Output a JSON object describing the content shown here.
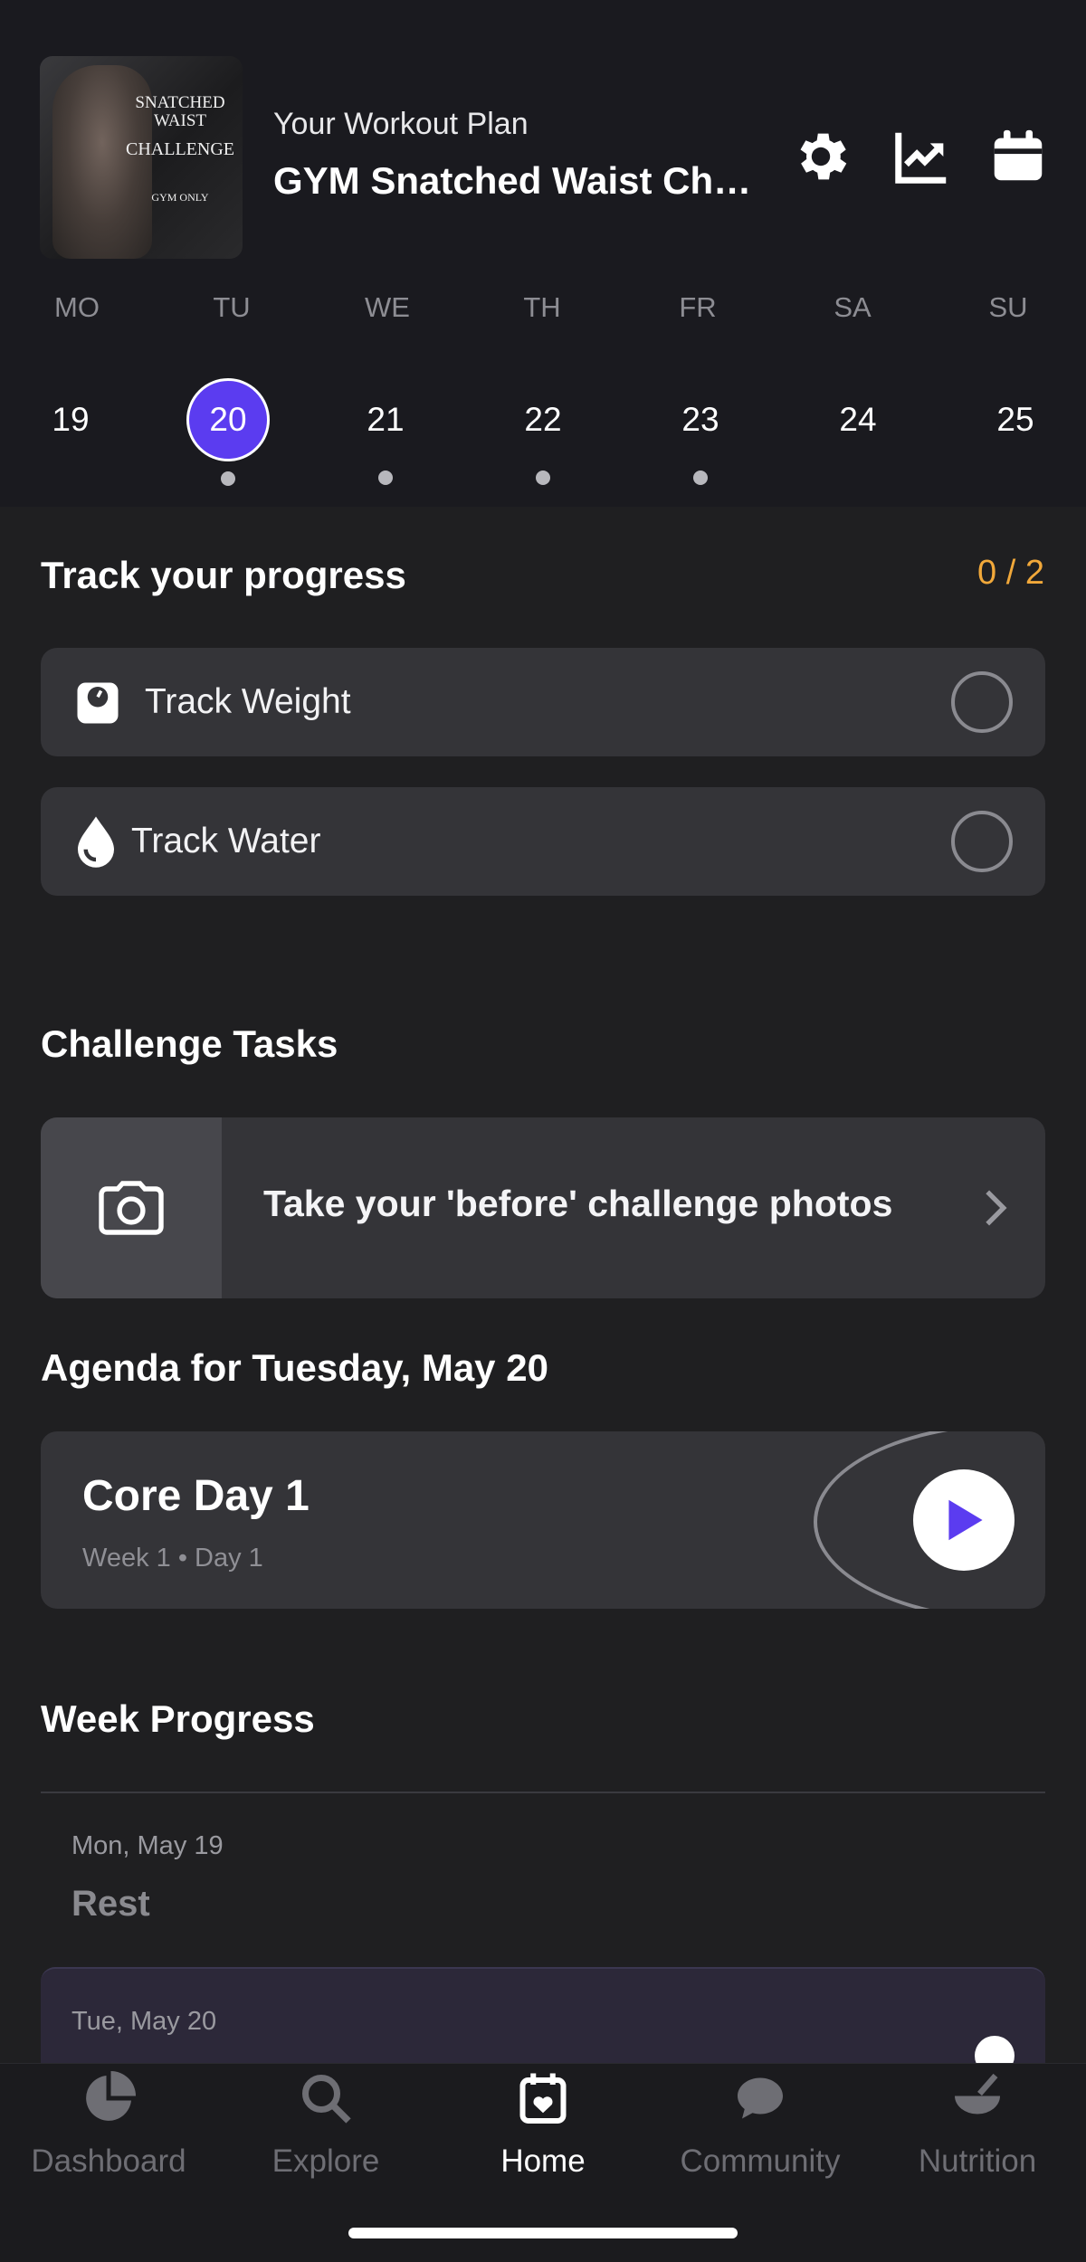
{
  "header": {
    "thumbnail": {
      "line1": "SNATCHED WAIST",
      "line2": "CHALLENGE",
      "line3": "GYM ONLY"
    },
    "plan_label": "Your Workout Plan",
    "plan_title": "GYM Snatched Waist Chal…",
    "icons": [
      "gear-icon",
      "chart-icon",
      "calendar-icon"
    ]
  },
  "week": {
    "day_labels": [
      "MO",
      "TU",
      "WE",
      "TH",
      "FR",
      "SA",
      "SU"
    ],
    "dates": [
      "19",
      "20",
      "21",
      "22",
      "23",
      "24",
      "25"
    ],
    "selected": "20"
  },
  "progress": {
    "title": "Track your progress",
    "count": "0 / 2",
    "items": [
      {
        "label": "Track Weight",
        "icon": "scale-icon"
      },
      {
        "label": "Track Water",
        "icon": "water-drop-icon"
      }
    ]
  },
  "tasks": {
    "title": "Challenge Tasks",
    "items": [
      {
        "label": "Take your 'before' challenge photos",
        "icon": "camera-icon"
      }
    ]
  },
  "agenda": {
    "title": "Agenda for Tuesday, May 20",
    "workout": {
      "name": "Core Day 1",
      "sub": "Week 1 • Day 1"
    }
  },
  "week_progress": {
    "title": "Week Progress",
    "rows": [
      {
        "date": "Mon, May 19",
        "name": "Rest"
      },
      {
        "date": "Tue, May 20",
        "name": ""
      }
    ]
  },
  "tabbar": {
    "tabs": [
      {
        "label": "Dashboard",
        "icon": "pie-chart-icon"
      },
      {
        "label": "Explore",
        "icon": "search-icon"
      },
      {
        "label": "Home",
        "icon": "calendar-heart-icon",
        "active": true
      },
      {
        "label": "Community",
        "icon": "chat-bubble-icon"
      },
      {
        "label": "Nutrition",
        "icon": "bowl-icon"
      }
    ]
  },
  "colors": {
    "accent": "#5b3cf0",
    "progress_count": "#f1a83a"
  }
}
